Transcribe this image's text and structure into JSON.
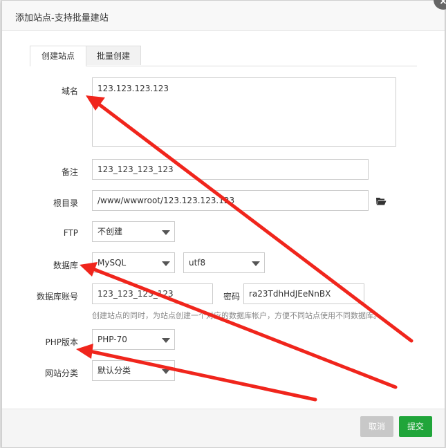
{
  "dialog": {
    "title": "添加站点-支持批量建站",
    "close": "×"
  },
  "tabs": [
    {
      "label": "创建站点",
      "active": true
    },
    {
      "label": "批量创建",
      "active": false
    }
  ],
  "form": {
    "domain": {
      "label": "域名",
      "value": "123.123.123.123"
    },
    "remark": {
      "label": "备注",
      "value": "123_123_123_123"
    },
    "root": {
      "label": "根目录",
      "value": "/www/wwwroot/123.123.123.123"
    },
    "ftp": {
      "label": "FTP",
      "value": "不创建"
    },
    "database": {
      "label": "数据库",
      "type": "MySQL",
      "charset": "utf8"
    },
    "db_account": {
      "label": "数据库账号",
      "value": "123_123_123_123",
      "password_label": "密码",
      "password": "ra23TdhHdJEeNnBX"
    },
    "db_hint": "创建站点的同时，为站点创建一个对应的数据库帐户，方便不同站点使用不同数据库。",
    "php": {
      "label": "PHP版本",
      "value": "PHP-70"
    },
    "category": {
      "label": "网站分类",
      "value": "默认分类"
    }
  },
  "buttons": {
    "cancel": "取消",
    "submit": "提交"
  },
  "colors": {
    "submit": "#20a53a",
    "cancel": "#c8c8c8",
    "annotation_arrow": "#f0251c"
  }
}
